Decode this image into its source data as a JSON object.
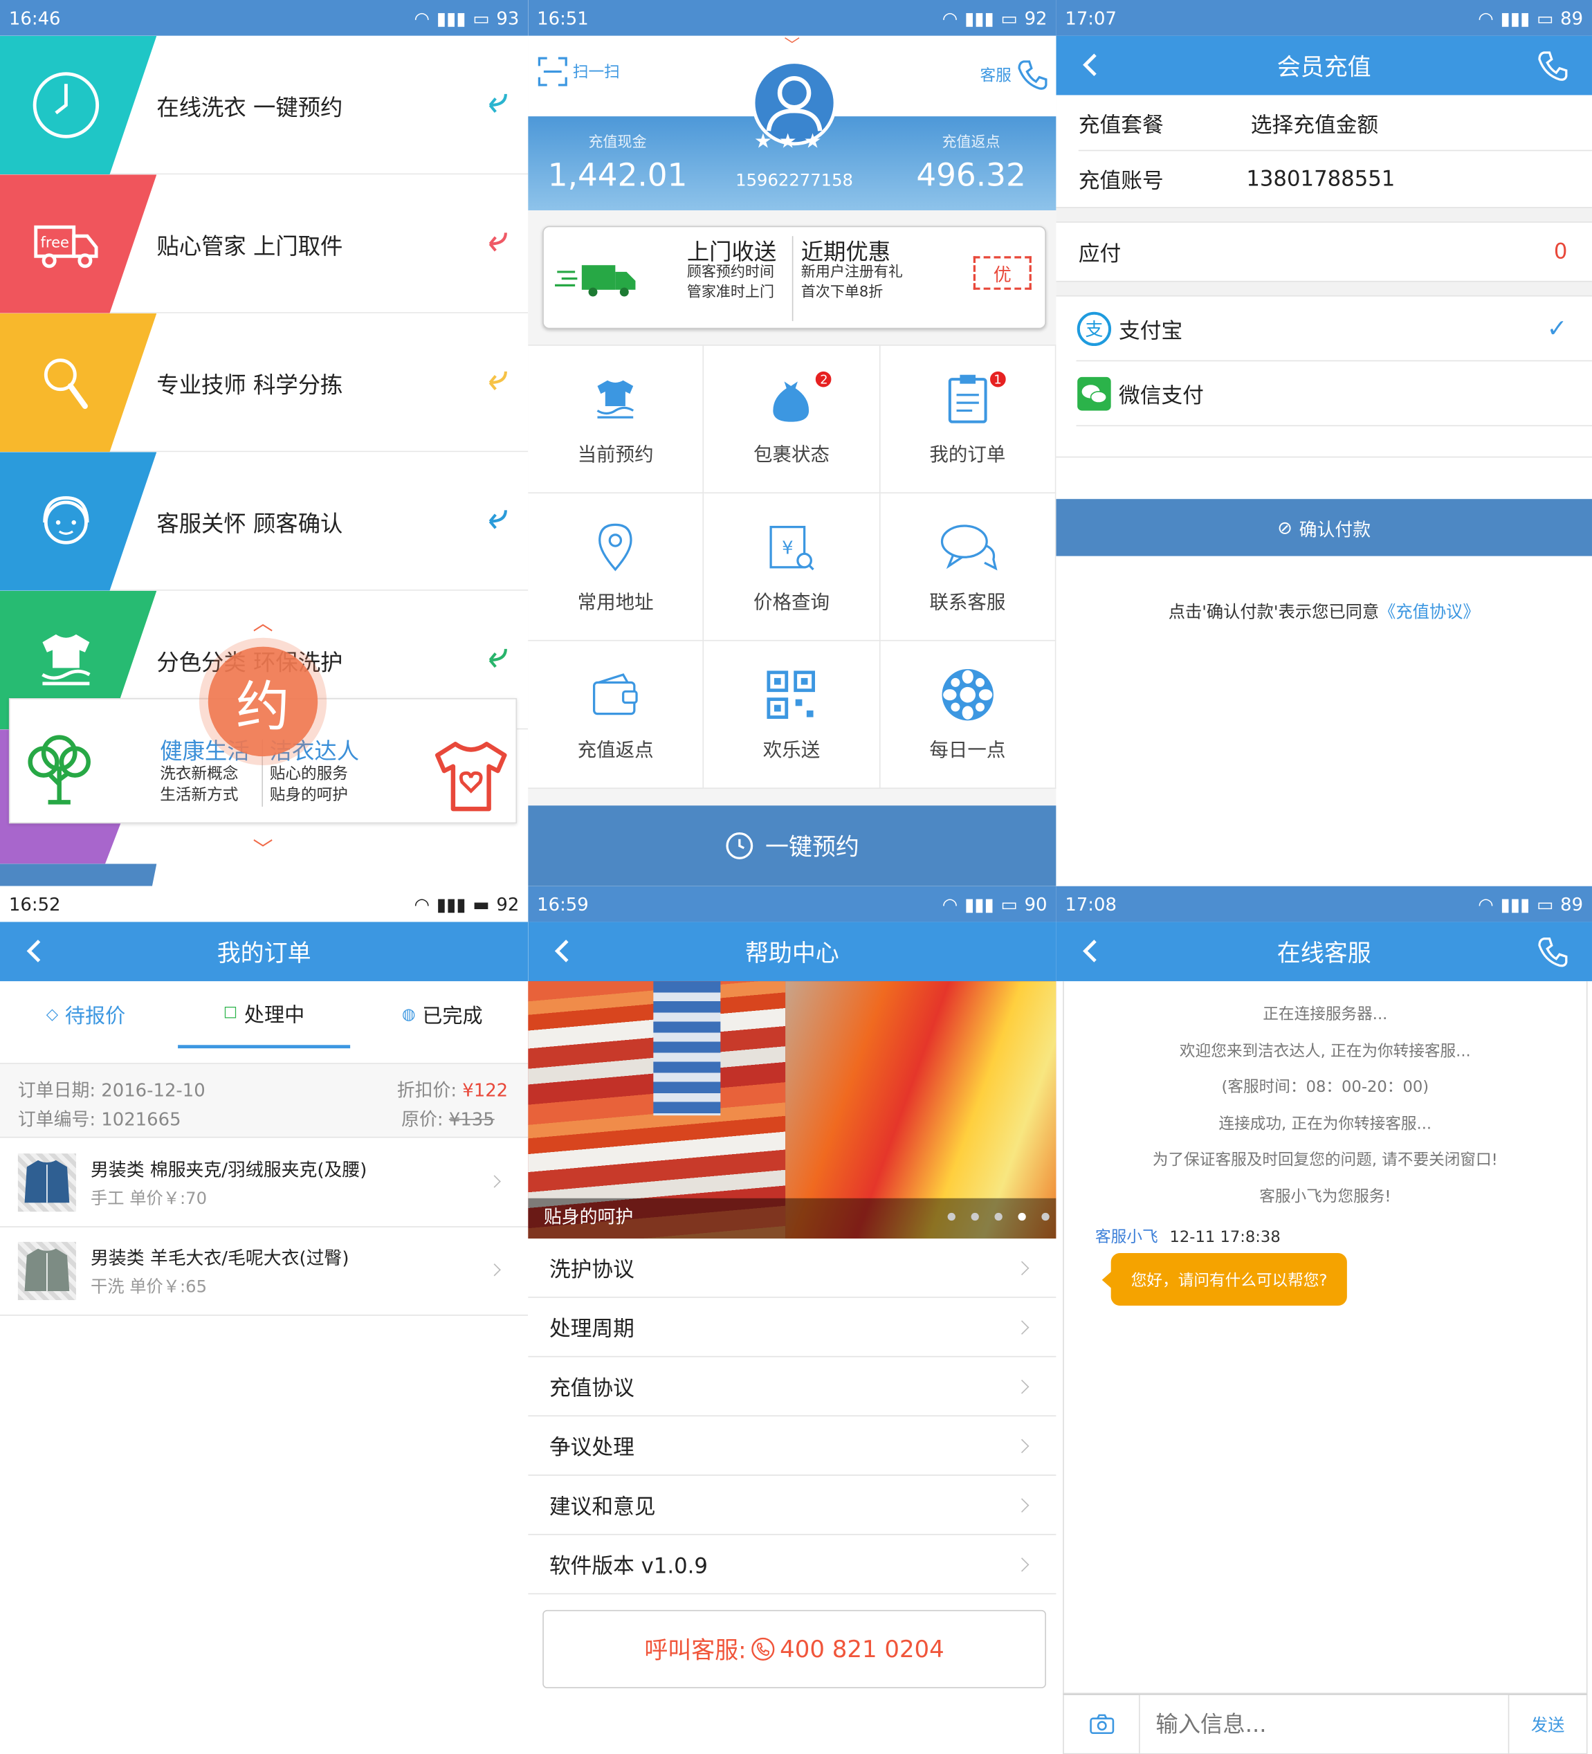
{
  "p1": {
    "time": "16:46",
    "battery": "93",
    "items": [
      {
        "label": "在线洗衣 一键预约",
        "color": "#1fc6c6",
        "arrow": "#2ab4cf"
      },
      {
        "label": "贴心管家 上门取件",
        "color": "#f0555c",
        "arrow": "#ef5965"
      },
      {
        "label": "专业技师 科学分拣",
        "color": "#f8b82c",
        "arrow": "#f6c246"
      },
      {
        "label": "客服关怀 顾客确认",
        "color": "#2b9bdc",
        "arrow": "#2a9bd9"
      },
      {
        "label": "分色分类 环保洗护",
        "color": "#27bb72",
        "arrow": "#28b46b"
      }
    ],
    "van_text": "free",
    "bubble": "约",
    "card": {
      "t1": "健康生活",
      "t2": "洁衣达人",
      "l1": "洗衣新概念",
      "l2": "生活新方式",
      "r1": "贴心的服务",
      "r2": "贴身的呵护"
    }
  },
  "p2": {
    "time": "16:51",
    "battery": "92",
    "scan": "扫一扫",
    "service": "客服",
    "cash_label": "充值现金",
    "cash": "1,442.01",
    "points_label": "充值返点",
    "points": "496.32",
    "phone": "15962277158",
    "promo": {
      "title1": "上门收送",
      "sub1a": "顾客预约时间",
      "sub1b": "管家准时上门",
      "title2": "近期优惠",
      "sub2a": "新用户注册有礼",
      "sub2b": "首次下单8折",
      "tag": "优"
    },
    "grid": [
      {
        "label": "当前预约",
        "badge": ""
      },
      {
        "label": "包裹状态",
        "badge": "2"
      },
      {
        "label": "我的订单",
        "badge": "1"
      },
      {
        "label": "常用地址",
        "badge": ""
      },
      {
        "label": "价格查询",
        "badge": ""
      },
      {
        "label": "联系客服",
        "badge": ""
      },
      {
        "label": "充值返点",
        "badge": ""
      },
      {
        "label": "欢乐送",
        "badge": ""
      },
      {
        "label": "每日一点",
        "badge": ""
      }
    ],
    "book": "一键预约"
  },
  "p3": {
    "time": "17:07",
    "battery": "89",
    "title": "会员充值",
    "pkg_label": "充值套餐",
    "pkg_value": "选择充值金额",
    "acct_label": "充值账号",
    "acct_value": "13801788551",
    "pay_label": "应付",
    "pay_value": "0",
    "alipay": "支付宝",
    "wechat": "微信支付",
    "confirm": "确认付款",
    "note": "点击'确认付款'表示您已同意",
    "link": "《充值协议》"
  },
  "p4": {
    "time": "16:52",
    "battery": "92",
    "title": "我的订单",
    "tabs": [
      "待报价",
      "处理中",
      "已完成"
    ],
    "date": "订单日期: 2016-12-10",
    "no": "订单编号: 1021665",
    "disc_label": "折扣价: ",
    "disc": "¥122",
    "orig_label": "原价: ",
    "orig": "¥135",
    "orders": [
      {
        "name": "男装类 棉服夹克/羽绒服夹克(及腰)",
        "sub": "手工 单价￥:70"
      },
      {
        "name": "男装类 羊毛大衣/毛呢大衣(过臀)",
        "sub": "干洗 单价￥:65"
      }
    ]
  },
  "p5": {
    "time": "16:59",
    "battery": "90",
    "title": "帮助中心",
    "banner": "贴身的呵护",
    "items": [
      "洗护协议",
      "处理周期",
      "充值协议",
      "争议处理",
      "建议和意见",
      "软件版本 v1.0.9"
    ],
    "call_label": "呼叫客服:",
    "call_number": "400 821 0204"
  },
  "p6": {
    "time": "17:08",
    "battery": "89",
    "title": "在线客服",
    "msgs": [
      "正在连接服务器...",
      "欢迎您来到洁衣达人, 正在为你转接客服...",
      "(客服时间：08：00-20：00)",
      "连接成功, 正在为你转接客服...",
      "为了保证客服及时回复您的问题, 请不要关闭窗口!",
      "客服小飞为您服务!"
    ],
    "agent": "客服小飞",
    "stamp": "12-11 17:8:38",
    "bubble": "您好，请问有什么可以帮您?",
    "placeholder": "输入信息...",
    "send": "发送"
  }
}
